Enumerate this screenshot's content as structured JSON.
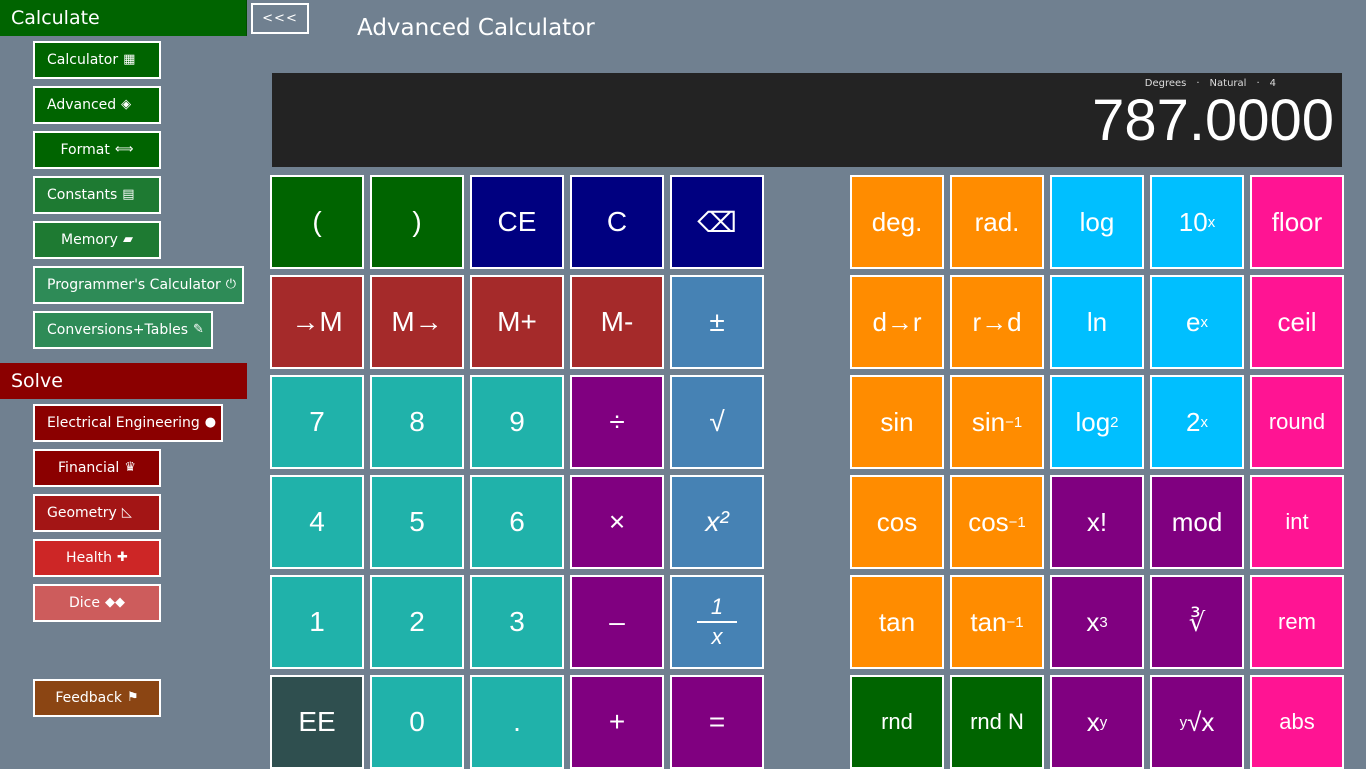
{
  "sidebar": {
    "calculate_header": "Calculate",
    "calculate_items": [
      {
        "label": "Calculator",
        "icon": "calculator-icon",
        "glyph": "▦",
        "color": "#006400"
      },
      {
        "label": "Advanced",
        "icon": "graduation-cap-icon",
        "glyph": "◈",
        "color": "#006400"
      },
      {
        "label": "Format",
        "icon": "left-right-arrow-icon",
        "glyph": "⟺",
        "color": "#006400"
      },
      {
        "label": "Constants",
        "icon": "keyboard-icon",
        "glyph": "▤",
        "color": "#1e7a32"
      },
      {
        "label": "Memory",
        "icon": "memory-chip-icon",
        "glyph": "▰",
        "color": "#1e7a32"
      },
      {
        "label": "Programmer's Calculator",
        "icon": "power-icon",
        "glyph": "⏻",
        "color": "#2e8b57"
      },
      {
        "label": "Conversions+Tables",
        "icon": "pencil-icon",
        "glyph": "✎",
        "color": "#2e8b57"
      }
    ],
    "solve_header": "Solve",
    "solve_items": [
      {
        "label": "Electrical Engineering",
        "icon": "lightbulb-icon",
        "glyph": "●",
        "color": "#8b0000"
      },
      {
        "label": "Financial",
        "icon": "money-bag-icon",
        "glyph": "♛",
        "color": "#8b0000"
      },
      {
        "label": "Geometry",
        "icon": "triangle-ruler-icon",
        "glyph": "◺",
        "color": "#a31515"
      },
      {
        "label": "Health",
        "icon": "heart-icon",
        "glyph": "✚",
        "color": "#cd2626"
      },
      {
        "label": "Dice",
        "icon": "dice-icon",
        "glyph": "◆◆",
        "color": "#cd5c5c"
      }
    ],
    "feedback": {
      "label": "Feedback",
      "icon": "person-icon",
      "glyph": "⚑",
      "color": "#8b4513"
    }
  },
  "back_button": "<<<",
  "app_title": "Advanced Calculator",
  "display": {
    "angle_mode": "Degrees",
    "dot1": "·",
    "number_mode": "Natural",
    "dot2": "·",
    "precision": "4",
    "value": "787.0000"
  },
  "colors": {
    "paren": "#006400",
    "clear": "#000080",
    "memory": "#a52a2a",
    "digit": "#20b2aa",
    "operator": "#800080",
    "steelblue": "#4682b4",
    "ee": "#2f4f4f",
    "orange": "#ff8c00",
    "cyan": "#00bfff",
    "pink": "#ff1493",
    "green": "#006400"
  },
  "keys_left": {
    "open_paren": "(",
    "close_paren": ")",
    "ce": "CE",
    "c": "C",
    "backspace": "⌫",
    "to_mem": "→M",
    "from_mem": "M→",
    "mem_plus": "M+",
    "mem_minus": "M-",
    "plus_minus": "±",
    "seven": "7",
    "eight": "8",
    "nine": "9",
    "divide": "÷",
    "sqrt": "√",
    "four": "4",
    "five": "5",
    "six": "6",
    "multiply": "×",
    "square": "x²",
    "one": "1",
    "two": "2",
    "three": "3",
    "minus": "–",
    "recip_num": "1",
    "recip_den": "x",
    "ee": "EE",
    "zero": "0",
    "dot": ".",
    "plus": "+",
    "equals": "="
  },
  "keys_right": {
    "deg": "deg.",
    "rad": "rad.",
    "log": "log",
    "ten_pow_base": "10",
    "ten_pow_exp": "x",
    "floor": "floor",
    "d_to_r": "d→r",
    "r_to_d": "r→d",
    "ln": "ln",
    "e_pow_base": "e",
    "e_pow_exp": "x",
    "ceil": "ceil",
    "sin": "sin",
    "asin_base": "sin",
    "asin_exp": "−1",
    "log2_base": "log",
    "log2_sub": "2",
    "two_pow_base": "2",
    "two_pow_exp": "x",
    "round": "round",
    "cos": "cos",
    "acos_base": "cos",
    "acos_exp": "−1",
    "fact": "x!",
    "mod": "mod",
    "int": "int",
    "tan": "tan",
    "atan_base": "tan",
    "atan_exp": "−1",
    "cube_base": "x",
    "cube_exp": "3",
    "cbrt": "∛",
    "rem": "rem",
    "rnd": "rnd",
    "rnd_n": "rnd N",
    "xy_base": "x",
    "xy_exp": "y",
    "yroot_pre": "y",
    "yroot_main": "√x",
    "abs": "abs"
  }
}
